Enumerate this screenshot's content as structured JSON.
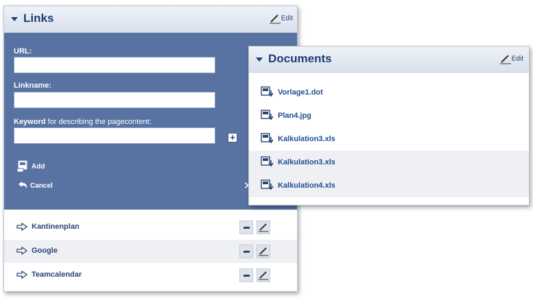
{
  "links_panel": {
    "title": "Links",
    "edit_label": "Edit",
    "form": {
      "url_label": "URL:",
      "url_value": "",
      "linkname_label": "Linkname:",
      "linkname_value": "",
      "keyword_label_bold": "Keyword",
      "keyword_label_rest": " for describing the pagecontent:",
      "keyword_value": "",
      "add_label": "Add",
      "cancel_label": "Cancel"
    },
    "links": [
      {
        "label": "Kantinenplan"
      },
      {
        "label": "Google"
      },
      {
        "label": "Teamcalendar"
      }
    ]
  },
  "documents_panel": {
    "title": "Documents",
    "edit_label": "Edit",
    "files": [
      {
        "label": "Vorlage1.dot"
      },
      {
        "label": "Plan4.jpg"
      },
      {
        "label": "Kalkulation3.xls"
      },
      {
        "label": "Kalkulation3.xls"
      },
      {
        "label": "Kalkulation4.xls"
      }
    ]
  },
  "colors": {
    "header_text": "#1e3f72",
    "form_background": "#5873a2",
    "link_text": "#2a4670",
    "doc_text": "#1f4d8f"
  }
}
